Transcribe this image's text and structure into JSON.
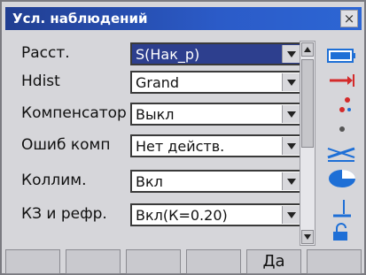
{
  "window": {
    "title": "Усл. наблюдений",
    "close_label": "×"
  },
  "settings": [
    {
      "label": "Расст.",
      "value": "S(Нак_р)"
    },
    {
      "label": "Hdist",
      "value": "Grand"
    },
    {
      "label": "Компенсатор",
      "value": "Выкл"
    },
    {
      "label": "Ошиб комп",
      "value": "Нет действ."
    },
    {
      "label": "Коллим.",
      "value": "Вкл"
    },
    {
      "label": "КЗ и рефр.",
      "value": "Вкл(К=0.20)"
    }
  ],
  "side_icons": [
    "battery-icon",
    "target-mode-icon",
    "edm-icon",
    "dot-icon",
    "tilt-icon",
    "disk-icon",
    "level-icon",
    "lock-icon"
  ],
  "softkeys": [
    "",
    "",
    "",
    "",
    "Да",
    ""
  ],
  "colors": {
    "title_bar": "#2b5bc8",
    "selected_field": "#2d3f8e",
    "icon_blue": "#1e6fd6",
    "icon_red": "#d42a2a"
  }
}
